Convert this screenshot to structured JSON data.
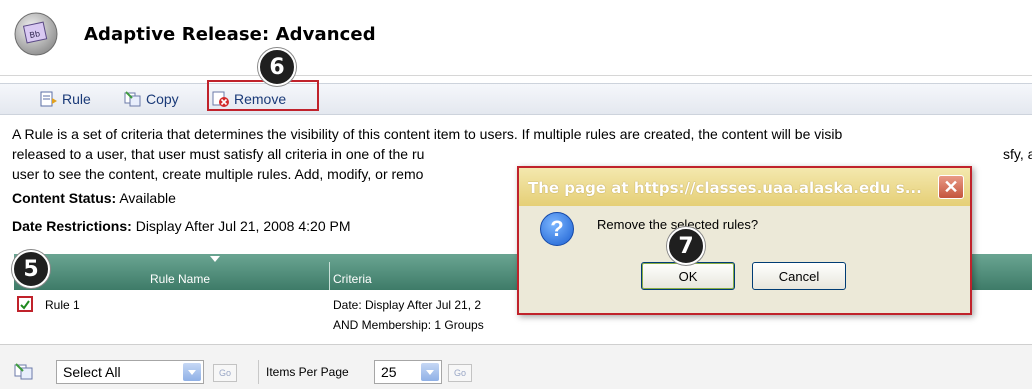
{
  "header": {
    "title": "Adaptive Release: Advanced",
    "logo_icon": "blackboard-logo-icon"
  },
  "toolbar": {
    "rule_label": "Rule",
    "copy_label": "Copy",
    "remove_label": "Remove"
  },
  "description": {
    "lines": [
      "A Rule is a set of criteria that determines the visibility of this content item to users. If multiple rules are created, the content will be visib",
      "released to a user, that user must satisfy all criteria in one of the ru",
      "user to see the content, create multiple rules. Add, modify, or remo"
    ],
    "line2_tail": "sfy, add"
  },
  "status": {
    "content_status_label": "Content Status:",
    "content_status_value": "Available",
    "date_restrictions_label": "Date Restrictions:",
    "date_restrictions_value": "Display After Jul 21, 2008 4:20 PM"
  },
  "table": {
    "columns": [
      "Rule Name",
      "Criteria"
    ],
    "rows": [
      {
        "checked": true,
        "name": "Rule 1",
        "criteria": [
          "Date: Display After Jul 21, 2",
          "AND Membership: 1 Groups"
        ]
      }
    ]
  },
  "bottom_bar": {
    "select_value": "Select All",
    "go_label": "Go",
    "items_per_page_label": "Items Per Page",
    "items_per_page_value": "25"
  },
  "dialog": {
    "title": "The page at https://classes.uaa.alaska.edu s...",
    "message": "Remove the selected rules?",
    "ok_label": "OK",
    "cancel_label": "Cancel",
    "close_glyph": "✕"
  },
  "callouts": {
    "step5": "5",
    "step6": "6",
    "step7": "7"
  },
  "colors": {
    "highlight": "#c0222b",
    "table_header": "#4f8c78",
    "dialog_title": "#e9d588"
  }
}
